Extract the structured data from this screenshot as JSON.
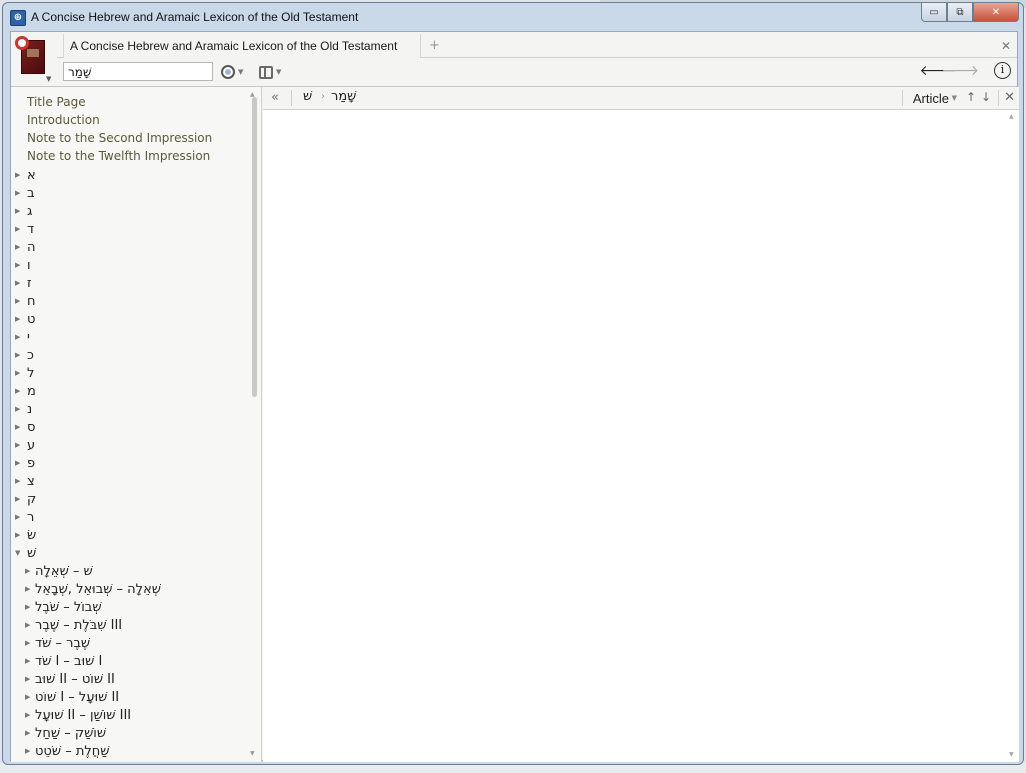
{
  "window": {
    "title": "A Concise Hebrew and Aramaic Lexicon of the Old Testament",
    "app_icon": "logos-icon",
    "minimize": "▭",
    "maximize": "⧉",
    "close": "✕"
  },
  "book": {
    "tab_title": "A Concise Hebrew and Aramaic Lexicon of the Old Testament",
    "add_tab": "+",
    "close_all": "✕"
  },
  "toolbar": {
    "search_value": "שָׁמַר",
    "back": "🡐",
    "forward": "🡒",
    "info": "i"
  },
  "toc": {
    "front_matter": [
      "Title Page",
      "Introduction",
      "Note to the Second Impression",
      "Note to the Twelfth Impression"
    ],
    "letters": [
      "א",
      "ב",
      "ג",
      "ד",
      "ה",
      "ו",
      "ז",
      "ח",
      "ט",
      "י",
      "כ",
      "ל",
      "מ",
      "נ",
      "ס",
      "ע",
      "פ",
      "צ",
      "ק",
      "ר",
      "שׂ",
      "שׁ"
    ],
    "expanded_letter": "שׁ",
    "entries": [
      "שׁ – שְׁאֵלָה",
      "שְׁאֵלָה – שְׁבוּאֵל ,שְׁבָאֵל",
      "שְׁבוֹל – שֹׁבֶל",
      "שִׁבֹּלֶת – שֶׁבֶר III",
      "שֶׁבֶר – שֹׁד",
      "שֹׁד I – שׁוּב I",
      "שׁוּב II – שׁוֹט II",
      "שׁוֹט I – שׁוּעָל II",
      "שׁוּעָל II – שׁוֹשַׁן III",
      "שׁוֹשַׁק – שַׁחַל",
      "שַׁחֲלֶת – שֹׁטֵט"
    ]
  },
  "content": {
    "collapse": "«",
    "breadcrumb": [
      "שׁ",
      "שָׁמַר"
    ],
    "breadcrumb_sep": "›",
    "view_label": "Article",
    "up": "↑",
    "down": "↓",
    "close": "✕"
  }
}
